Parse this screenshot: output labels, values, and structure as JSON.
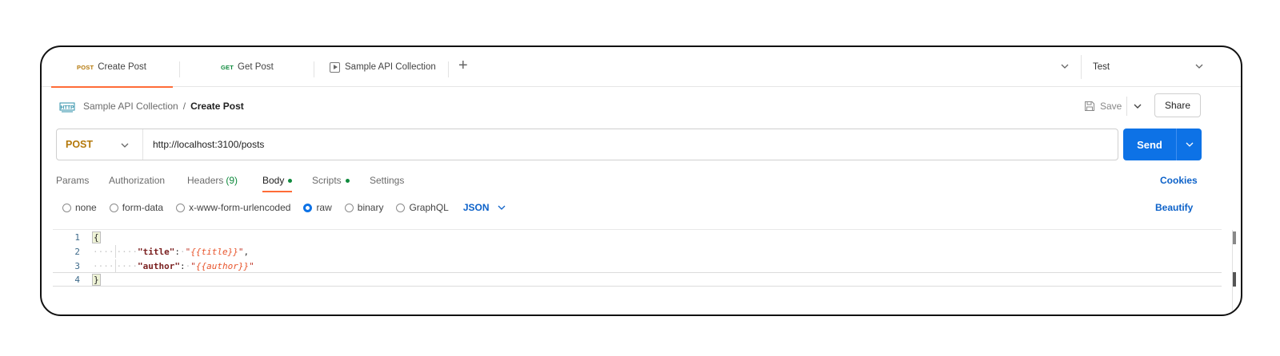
{
  "tabs": [
    {
      "method": "POST",
      "label": "Create Post",
      "active": true
    },
    {
      "method": "GET",
      "label": "Get Post",
      "active": false
    },
    {
      "label": "Sample API Collection",
      "icon": "play-box-icon"
    }
  ],
  "environment": {
    "name": "Test"
  },
  "breadcrumb": {
    "parent": "Sample API Collection",
    "separator": "/",
    "current": "Create Post"
  },
  "actions": {
    "save_label": "Save",
    "share_label": "Share"
  },
  "request": {
    "method": "POST",
    "url": "http://localhost:3100/posts",
    "send_label": "Send"
  },
  "request_tabs": [
    {
      "label": "Params"
    },
    {
      "label": "Authorization"
    },
    {
      "label": "Headers",
      "count": "(9)"
    },
    {
      "label": "Body",
      "active": true,
      "dot": true
    },
    {
      "label": "Scripts",
      "dot": true
    },
    {
      "label": "Settings"
    }
  ],
  "cookies_label": "Cookies",
  "body_types": [
    {
      "label": "none",
      "checked": false
    },
    {
      "label": "form-data",
      "checked": false
    },
    {
      "label": "x-www-form-urlencoded",
      "checked": false
    },
    {
      "label": "raw",
      "checked": true
    },
    {
      "label": "binary",
      "checked": false
    },
    {
      "label": "GraphQL",
      "checked": false
    }
  ],
  "language": "JSON",
  "beautify_label": "Beautify",
  "editor": {
    "line_numbers": [
      "1",
      "2",
      "3",
      "4"
    ],
    "open_brace": "{",
    "close_brace": "}",
    "fields": [
      {
        "key": "\"title\"",
        "colon": ":",
        "quote_open": "\"",
        "value": "{{title}}",
        "quote_close": "\"",
        "comma": ","
      },
      {
        "key": "\"author\"",
        "colon": ":",
        "quote_open": "\"",
        "value": "{{author}}",
        "quote_close": "\"",
        "comma": ""
      }
    ]
  },
  "colors": {
    "accent": "#ff6c37",
    "send": "#0d72e6",
    "post": "#b4780a",
    "get": "#0f8a3d",
    "link": "#0d62c9"
  }
}
